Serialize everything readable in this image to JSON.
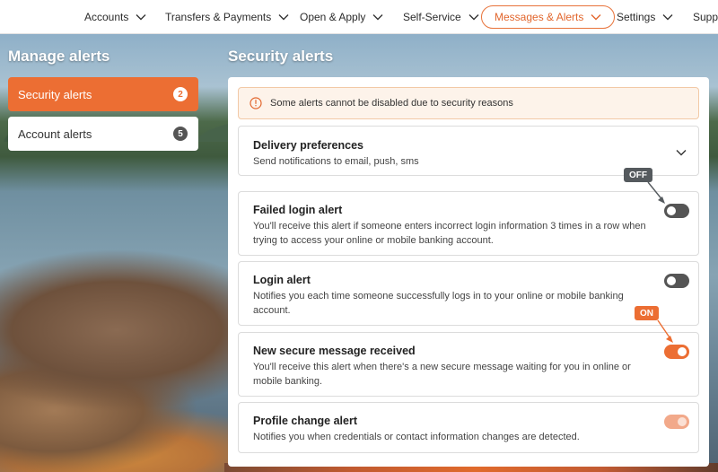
{
  "nav": {
    "items": [
      {
        "label": "Accounts"
      },
      {
        "label": "Transfers & Payments"
      },
      {
        "label": "Open & Apply"
      },
      {
        "label": "Self-Service"
      },
      {
        "label": "Messages & Alerts",
        "active": true
      },
      {
        "label": "Settings"
      },
      {
        "label": "Suppo"
      }
    ]
  },
  "sidebar": {
    "title": "Manage alerts",
    "items": [
      {
        "label": "Security alerts",
        "count": "2",
        "active": true
      },
      {
        "label": "Account alerts",
        "count": "5",
        "active": false
      }
    ]
  },
  "main": {
    "title": "Security alerts",
    "notice": "Some alerts cannot be disabled due to security reasons",
    "delivery": {
      "title": "Delivery preferences",
      "desc": "Send notifications to email, push, sms"
    },
    "alerts": [
      {
        "title": "Failed login alert",
        "desc": "You'll receive this alert if someone enters incorrect login information 3 times in a row when trying to access your online or mobile banking account.",
        "state": "off"
      },
      {
        "title": "Login alert",
        "desc": "Notifies you each time someone successfully logs in to your online or mobile banking account.",
        "state": "off"
      },
      {
        "title": "New secure message received",
        "desc": "You'll receive this alert when there's a new secure message waiting for you in online or mobile banking.",
        "state": "on"
      },
      {
        "title": "Profile change alert",
        "desc": "Notifies you when credentials or contact information changes are detected.",
        "state": "on-disabled"
      }
    ]
  },
  "callouts": {
    "off": "OFF",
    "on": "ON"
  },
  "colors": {
    "accent": "#ec6e33",
    "toggle_off": "#555555",
    "notice_bg": "#fdf3ea"
  }
}
